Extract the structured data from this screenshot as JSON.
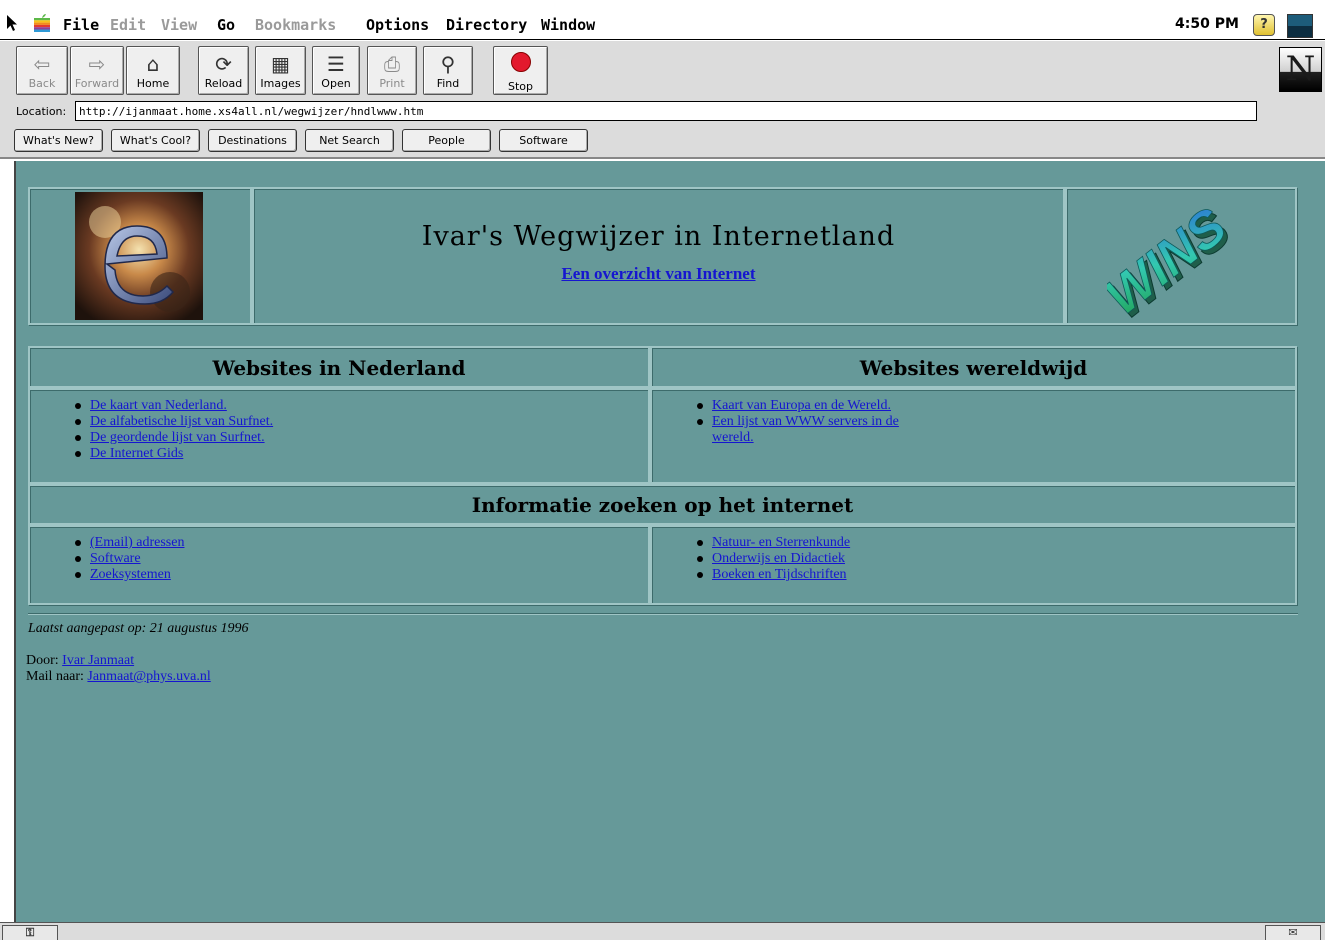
{
  "menubar": {
    "items": [
      {
        "label": "File",
        "enabled": true
      },
      {
        "label": "Edit",
        "enabled": false
      },
      {
        "label": "View",
        "enabled": false
      },
      {
        "label": "Go",
        "enabled": true
      },
      {
        "label": "Bookmarks",
        "enabled": false
      },
      {
        "label": "Options",
        "enabled": true
      },
      {
        "label": "Directory",
        "enabled": true
      },
      {
        "label": "Window",
        "enabled": true
      }
    ],
    "clock": "4:50 PM",
    "help_icon": "?"
  },
  "toolbar": {
    "buttons": [
      {
        "label": "Back",
        "icon": "back-arrow-icon",
        "enabled": false
      },
      {
        "label": "Forward",
        "icon": "forward-arrow-icon",
        "enabled": false
      },
      {
        "label": "Home",
        "icon": "home-icon",
        "enabled": true
      },
      {
        "label": "Reload",
        "icon": "reload-icon",
        "enabled": true
      },
      {
        "label": "Images",
        "icon": "images-icon",
        "enabled": true
      },
      {
        "label": "Open",
        "icon": "open-icon",
        "enabled": true
      },
      {
        "label": "Print",
        "icon": "print-icon",
        "enabled": false
      },
      {
        "label": "Find",
        "icon": "binoculars-icon",
        "enabled": true
      },
      {
        "label": "Stop",
        "icon": "stop-icon",
        "enabled": true
      }
    ],
    "logo": "N"
  },
  "location": {
    "label": "Location:",
    "url": "http://ijanmaat.home.xs4all.nl/wegwijzer/hndlwww.htm"
  },
  "directory_buttons": [
    "What's New?",
    "What's Cool?",
    "Destinations",
    "Net Search",
    "People",
    "Software"
  ],
  "page": {
    "title": "Ivar's Wegwijzer in Internetland",
    "subtitle_link": "Een overzicht van Internet",
    "right_logo_text": "WINS",
    "section_nl": {
      "heading": "Websites in Nederland",
      "links": [
        "De kaart van Nederland.",
        "De alfabetische lijst van Surfnet.",
        "De geordende lijst van Surfnet.",
        "De Internet Gids"
      ]
    },
    "section_world": {
      "heading": "Websites wereldwijd",
      "links": [
        "Kaart van Europa en de Wereld.",
        "Een lijst van WWW servers in de wereld."
      ]
    },
    "section_search": {
      "heading": "Informatie zoeken op het internet",
      "links_left": [
        "(Email) adressen",
        "Software",
        "Zoeksystemen"
      ],
      "links_right": [
        "Natuur- en Sterrenkunde",
        "Onderwijs en Didactiek",
        "Boeken en Tijdschriften"
      ]
    },
    "last_updated": "Laatst aangepast op: 21 augustus 1996",
    "author_label": "Door:",
    "author_name": "Ivar Janmaat",
    "mail_label": "Mail naar:",
    "mail_address": "Janmaat@phys.uva.nl"
  },
  "colors": {
    "page_background": "#669999",
    "link": "#1515d0",
    "chrome": "#dcdcdc"
  }
}
